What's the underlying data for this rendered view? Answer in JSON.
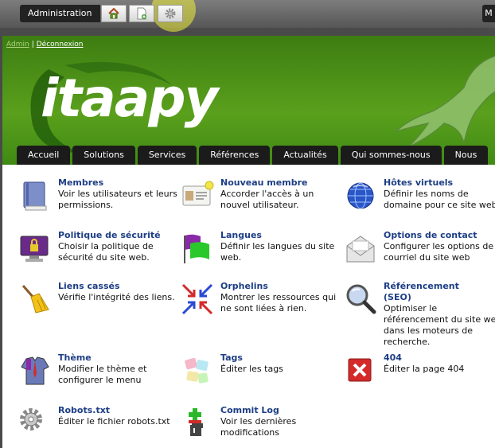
{
  "admin_bar": {
    "label": "Administration",
    "right_label": "M",
    "buttons": [
      {
        "icon": "home-icon"
      },
      {
        "icon": "new-page-icon"
      },
      {
        "icon": "gear-icon"
      }
    ]
  },
  "header": {
    "user_name": "Admin",
    "logout": "Déconnexion",
    "logo_text": "itaapy"
  },
  "nav": {
    "tabs": [
      "Accueil",
      "Solutions",
      "Services",
      "Références",
      "Actualités",
      "Qui sommes-nous",
      "Nous"
    ]
  },
  "items": [
    {
      "title": "Membres",
      "desc": "Voir les utilisateurs et leurs permissions.",
      "icon": "book-icon"
    },
    {
      "title": "Nouveau membre",
      "desc": "Accorder l'accès à un nouvel utilisateur.",
      "icon": "id-card-icon"
    },
    {
      "title": "Hôtes virtuels",
      "desc": "Définir les noms de domaine pour ce site web.",
      "icon": "globe-icon"
    },
    {
      "title": "Politique de sécurité",
      "desc": "Choisir la politique de sécurité du site web.",
      "icon": "lock-monitor-icon"
    },
    {
      "title": "Langues",
      "desc": "Définir les langues du site web.",
      "icon": "flags-icon"
    },
    {
      "title": "Options de contact",
      "desc": "Configurer les options de courriel du site web",
      "icon": "envelope-icon"
    },
    {
      "title": "Liens cassés",
      "desc": "Vérifie l'intégrité des liens.",
      "icon": "broom-icon"
    },
    {
      "title": "Orphelins",
      "desc": "Montrer les ressources qui ne sont liées à rien.",
      "icon": "converging-arrows-icon"
    },
    {
      "title": "Référencement (SEO)",
      "desc": "Optimiser le référencement du site web dans les moteurs de recherche.",
      "icon": "magnifier-icon"
    },
    {
      "title": "Thème",
      "desc": "Modifier le thème et configurer le menu",
      "icon": "shirt-icon"
    },
    {
      "title": "Tags",
      "desc": "Éditer les tags",
      "icon": "tags-icon"
    },
    {
      "title": "404",
      "desc": "Éditer la page 404",
      "icon": "error-x-icon"
    },
    {
      "title": "Robots.txt",
      "desc": "Éditer le fichier robots.txt",
      "icon": "gear-icon"
    },
    {
      "title": "Commit Log",
      "desc": "Voir les dernières modifications",
      "icon": "git-icon"
    }
  ]
}
